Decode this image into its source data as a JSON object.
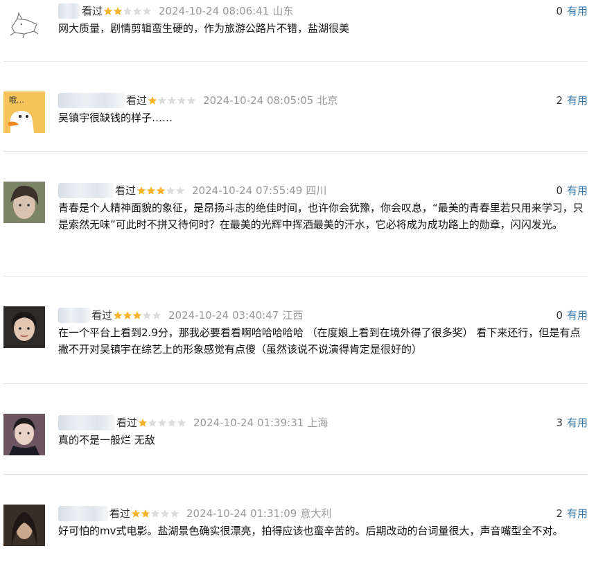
{
  "reviews": [
    {
      "user": "用户",
      "status": "看过",
      "rating": 2,
      "time": "2024-10-24 08:06:41",
      "location": "山东",
      "useful_count": "0",
      "useful_label": "有用",
      "content": "网大质量，剧情剪辑蛮生硬的，作为旅游公路片不错，盐湖很美",
      "avatar": "sketch-cat"
    },
    {
      "user": "用户",
      "status": "看过",
      "rating": 1,
      "time": "2024-10-24 08:05:05",
      "location": "北京",
      "useful_count": "2",
      "useful_label": "有用",
      "content": "吴镇宇很缺钱的样子……",
      "avatar": "duck"
    },
    {
      "user": "用户",
      "status": "看过",
      "rating": 3,
      "time": "2024-10-24 07:55:49",
      "location": "四川",
      "useful_count": "0",
      "useful_label": "有用",
      "content": "青春是个人精神面貌的象征，是昂扬斗志的绝佳时间，也许你会犹豫，你会叹息，“最美的青春里若只用来学习，只是索然无味”可此时不拼又待何时？在最美的光辉中挥洒最美的汗水，它必将成为成功路上的勋章，闪闪发光。",
      "avatar": "photo"
    },
    {
      "user": "用户",
      "status": "看过",
      "rating": 3,
      "time": "2024-10-24 03:40:47",
      "location": "江西",
      "useful_count": "0",
      "useful_label": "有用",
      "content": "在一个平台上看到2.9分，那我必要看看啊哈哈哈哈哈 （在度娘上看到在境外得了很多奖） 看下来还行，但是有点撇不开对吴镇宇在综艺上的形象感觉有点傻（虽然该说不说演得肯定是很好的）",
      "avatar": "photo"
    },
    {
      "user": "用户",
      "status": "看过",
      "rating": 1,
      "time": "2024-10-24 01:39:31",
      "location": "上海",
      "useful_count": "3",
      "useful_label": "有用",
      "content": "真的不是一般烂 无敌",
      "avatar": "photo"
    },
    {
      "user": "用户",
      "status": "看过",
      "rating": 2,
      "time": "2024-10-24 01:31:09",
      "location": "意大利",
      "useful_count": "2",
      "useful_label": "有用",
      "content": "好可怕的mv式电影。盐湖景色确实很漂亮，拍得应该也蛮辛苦的。后期改动的台词量很大，声音嘴型全不对。",
      "avatar": "photo"
    }
  ],
  "avatar_text": "哦…",
  "colors": {
    "star_on": "#f7b32b",
    "star_off": "#dcdcdc",
    "link": "#3377aa",
    "meta": "#999999"
  }
}
